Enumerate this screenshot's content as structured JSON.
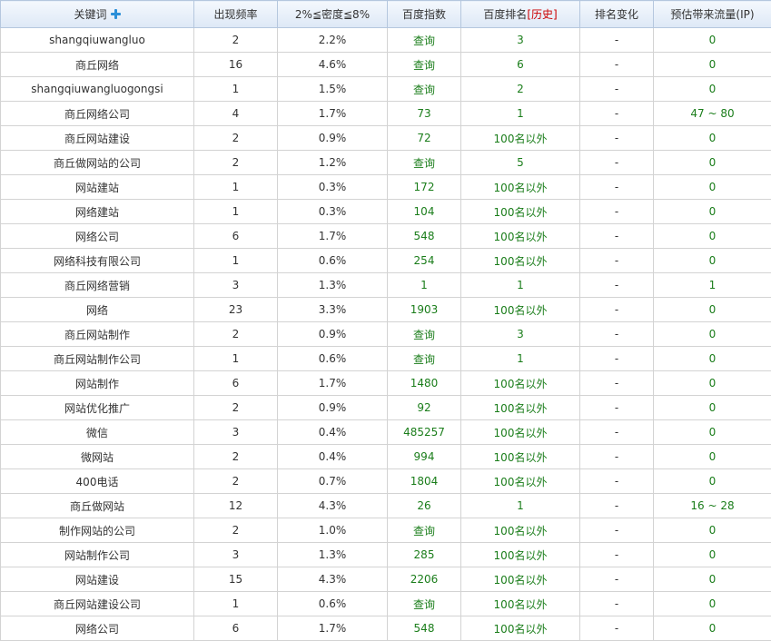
{
  "header": {
    "keyword": "关键词",
    "frequency": "出现频率",
    "density": "2%≦密度≦8%",
    "baidu_index": "百度指数",
    "baidu_rank": "百度排名",
    "history_bracket_open": "[",
    "history": "历史",
    "history_bracket_close": "]",
    "rank_change": "排名变化",
    "traffic": "预估带来流量(IP)"
  },
  "rows": [
    {
      "keyword": "shangqiuwangluo",
      "frequency": "2",
      "density": "2.2%",
      "baidu_index": "查询",
      "baidu_rank": "3",
      "rank_change": "-",
      "traffic": "0"
    },
    {
      "keyword": "商丘网络",
      "frequency": "16",
      "density": "4.6%",
      "baidu_index": "查询",
      "baidu_rank": "6",
      "rank_change": "-",
      "traffic": "0"
    },
    {
      "keyword": "shangqiuwangluogongsi",
      "frequency": "1",
      "density": "1.5%",
      "baidu_index": "查询",
      "baidu_rank": "2",
      "rank_change": "-",
      "traffic": "0"
    },
    {
      "keyword": "商丘网络公司",
      "frequency": "4",
      "density": "1.7%",
      "baidu_index": "73",
      "baidu_rank": "1",
      "rank_change": "-",
      "traffic": "47 ~ 80"
    },
    {
      "keyword": "商丘网站建设",
      "frequency": "2",
      "density": "0.9%",
      "baidu_index": "72",
      "baidu_rank": "100名以外",
      "rank_change": "-",
      "traffic": "0"
    },
    {
      "keyword": "商丘做网站的公司",
      "frequency": "2",
      "density": "1.2%",
      "baidu_index": "查询",
      "baidu_rank": "5",
      "rank_change": "-",
      "traffic": "0"
    },
    {
      "keyword": "网站建站",
      "frequency": "1",
      "density": "0.3%",
      "baidu_index": "172",
      "baidu_rank": "100名以外",
      "rank_change": "-",
      "traffic": "0"
    },
    {
      "keyword": "网络建站",
      "frequency": "1",
      "density": "0.3%",
      "baidu_index": "104",
      "baidu_rank": "100名以外",
      "rank_change": "-",
      "traffic": "0"
    },
    {
      "keyword": "网络公司",
      "frequency": "6",
      "density": "1.7%",
      "baidu_index": "548",
      "baidu_rank": "100名以外",
      "rank_change": "-",
      "traffic": "0"
    },
    {
      "keyword": "网络科技有限公司",
      "frequency": "1",
      "density": "0.6%",
      "baidu_index": "254",
      "baidu_rank": "100名以外",
      "rank_change": "-",
      "traffic": "0"
    },
    {
      "keyword": "商丘网络营销",
      "frequency": "3",
      "density": "1.3%",
      "baidu_index": "1",
      "baidu_rank": "1",
      "rank_change": "-",
      "traffic": "1"
    },
    {
      "keyword": "网络",
      "frequency": "23",
      "density": "3.3%",
      "baidu_index": "1903",
      "baidu_rank": "100名以外",
      "rank_change": "-",
      "traffic": "0"
    },
    {
      "keyword": "商丘网站制作",
      "frequency": "2",
      "density": "0.9%",
      "baidu_index": "查询",
      "baidu_rank": "3",
      "rank_change": "-",
      "traffic": "0"
    },
    {
      "keyword": "商丘网站制作公司",
      "frequency": "1",
      "density": "0.6%",
      "baidu_index": "查询",
      "baidu_rank": "1",
      "rank_change": "-",
      "traffic": "0"
    },
    {
      "keyword": "网站制作",
      "frequency": "6",
      "density": "1.7%",
      "baidu_index": "1480",
      "baidu_rank": "100名以外",
      "rank_change": "-",
      "traffic": "0"
    },
    {
      "keyword": "网站优化推广",
      "frequency": "2",
      "density": "0.9%",
      "baidu_index": "92",
      "baidu_rank": "100名以外",
      "rank_change": "-",
      "traffic": "0"
    },
    {
      "keyword": "微信",
      "frequency": "3",
      "density": "0.4%",
      "baidu_index": "485257",
      "baidu_rank": "100名以外",
      "rank_change": "-",
      "traffic": "0"
    },
    {
      "keyword": "微网站",
      "frequency": "2",
      "density": "0.4%",
      "baidu_index": "994",
      "baidu_rank": "100名以外",
      "rank_change": "-",
      "traffic": "0"
    },
    {
      "keyword": "400电话",
      "frequency": "2",
      "density": "0.7%",
      "baidu_index": "1804",
      "baidu_rank": "100名以外",
      "rank_change": "-",
      "traffic": "0"
    },
    {
      "keyword": "商丘做网站",
      "frequency": "12",
      "density": "4.3%",
      "baidu_index": "26",
      "baidu_rank": "1",
      "rank_change": "-",
      "traffic": "16 ~ 28"
    },
    {
      "keyword": "制作网站的公司",
      "frequency": "2",
      "density": "1.0%",
      "baidu_index": "查询",
      "baidu_rank": "100名以外",
      "rank_change": "-",
      "traffic": "0"
    },
    {
      "keyword": "网站制作公司",
      "frequency": "3",
      "density": "1.3%",
      "baidu_index": "285",
      "baidu_rank": "100名以外",
      "rank_change": "-",
      "traffic": "0"
    },
    {
      "keyword": "网站建设",
      "frequency": "15",
      "density": "4.3%",
      "baidu_index": "2206",
      "baidu_rank": "100名以外",
      "rank_change": "-",
      "traffic": "0"
    },
    {
      "keyword": "商丘网站建设公司",
      "frequency": "1",
      "density": "0.6%",
      "baidu_index": "查询",
      "baidu_rank": "100名以外",
      "rank_change": "-",
      "traffic": "0"
    },
    {
      "keyword": "网络公司",
      "frequency": "6",
      "density": "1.7%",
      "baidu_index": "548",
      "baidu_rank": "100名以外",
      "rank_change": "-",
      "traffic": "0"
    }
  ],
  "icons": {
    "add_keyword": "plus-icon"
  },
  "colors": {
    "link_green": "#1a7d1a",
    "history_red": "#cc0000",
    "plus_blue": "#2a8fd8"
  }
}
